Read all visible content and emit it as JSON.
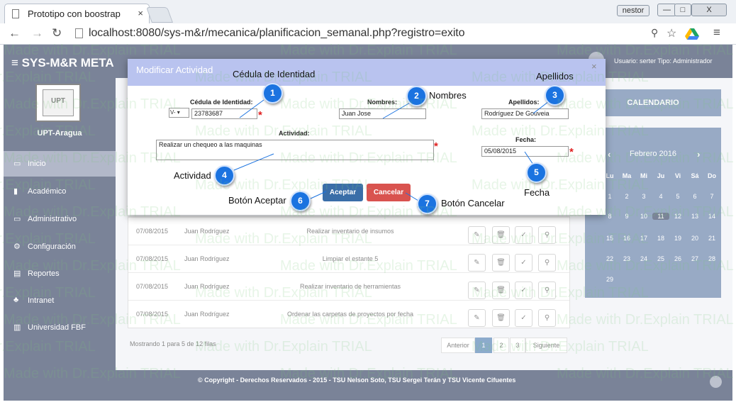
{
  "browser": {
    "tab_title": "Prototipo con boostrap",
    "tab_close": "×",
    "user_chip": "nestor",
    "url": "localhost:8080/sys-m&r/mecanica/planificacion_semanal.php?registro=exito",
    "win_min": "—",
    "win_max": "□",
    "win_close": "X"
  },
  "app": {
    "brand": "≡  SYS-M&R  META",
    "user_info": "Usuario: serter   Tipo: Administrador",
    "campus": "UPT-Aragua",
    "logo_text": "UPT"
  },
  "sidebar": {
    "items": [
      {
        "icon": "home-icon",
        "glyph": "▭",
        "label": "Inicio"
      },
      {
        "icon": "book-icon",
        "glyph": "▮",
        "label": "Académico"
      },
      {
        "icon": "monitor-icon",
        "glyph": "▭",
        "label": "Administrativo"
      },
      {
        "icon": "cogs-icon",
        "glyph": "⚙",
        "label": "Configuración"
      },
      {
        "icon": "report-icon",
        "glyph": "▤",
        "label": "Reportes"
      },
      {
        "icon": "sitemap-icon",
        "glyph": "♣",
        "label": "Intranet"
      },
      {
        "icon": "bank-icon",
        "glyph": "▥",
        "label": "Universidad FBF"
      }
    ]
  },
  "calendar": {
    "header": "CALENDARIO",
    "month": "Febrero 2016",
    "prev": "‹",
    "next": "›",
    "weekdays": [
      "Lu",
      "Ma",
      "Mi",
      "Ju",
      "Vi",
      "Sá",
      "Do"
    ],
    "weeks": [
      [
        "1",
        "2",
        "3",
        "4",
        "5",
        "6",
        "7"
      ],
      [
        "8",
        "9",
        "10",
        "11",
        "12",
        "13",
        "14"
      ],
      [
        "15",
        "16",
        "17",
        "18",
        "19",
        "20",
        "21"
      ],
      [
        "22",
        "23",
        "24",
        "25",
        "26",
        "27",
        "28"
      ],
      [
        "29",
        "",
        "",
        "",
        "",
        "",
        ""
      ]
    ],
    "today": "11"
  },
  "table": {
    "rows": [
      {
        "date": "07/08/2015",
        "name": "Juan Rodríguez",
        "activity": "Realizar inventario de insumos"
      },
      {
        "date": "07/08/2015",
        "name": "Juan Rodríguez",
        "activity": "Limpiar el estante 5"
      },
      {
        "date": "07/08/2015",
        "name": "Juan Rodríguez",
        "activity": "Realizar inventario de herramientas"
      },
      {
        "date": "07/08/2015",
        "name": "Juan Rodríguez",
        "activity": "Ordenar las carpetas de proyectos por fecha"
      }
    ],
    "showing": "Mostrando 1 para 5 de 12 filas",
    "pagination": {
      "prev": "Anterior",
      "pages": [
        "1",
        "2",
        "3"
      ],
      "next": "Siguiente",
      "active": "1"
    }
  },
  "footer": {
    "text": "© Copyright - Derechos Reservados - 2015 - TSU Nelson Soto, TSU Sergei Terán y TSU Vicente Cifuentes"
  },
  "modal": {
    "title": "Modificar Actividad",
    "close": "×",
    "cedula_label": "Cédula de Identidad:",
    "cedula_prefix": "V-",
    "cedula_value": "23783687",
    "nombres_label": "Nombres:",
    "nombres_value": "Juan Jose",
    "apellidos_label": "Apellidos:",
    "apellidos_value": "Rodríguez De Gouveia",
    "actividad_label": "Actividad:",
    "actividad_value": "Realizar un chequeo a las maquinas",
    "fecha_label": "Fecha:",
    "fecha_value": "05/08/2015",
    "required": "*",
    "accept": "Aceptar",
    "cancel": "Cancelar"
  },
  "callouts": {
    "cedula": {
      "num": "1",
      "text": "Cédula de Identidad"
    },
    "nombres": {
      "num": "2",
      "text": "Nombres"
    },
    "apellidos": {
      "num": "3",
      "text": "Apellidos"
    },
    "actividad": {
      "num": "4",
      "text": "Actividad"
    },
    "fecha": {
      "num": "5",
      "text": "Fecha"
    },
    "aceptar": {
      "num": "6",
      "text": "Botón Aceptar"
    },
    "cancelar": {
      "num": "7",
      "text": "Botón Cancelar"
    }
  },
  "watermark": "Made with Dr.Explain TRIAL",
  "colors": {
    "navy": "#1a2a4e",
    "accent": "#3a6ea8",
    "callout": "#1b73e0",
    "cancel": "#d9534f",
    "required": "#e02020"
  }
}
